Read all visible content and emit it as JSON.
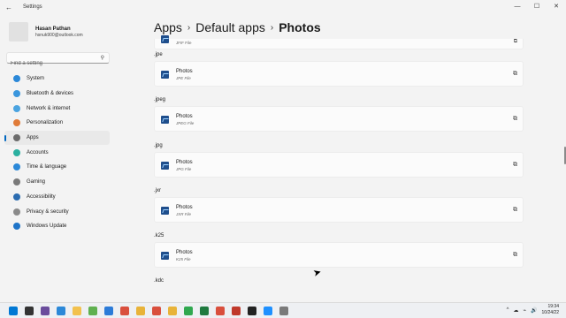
{
  "window": {
    "title": "Settings",
    "back_glyph": "←",
    "minimize_glyph": "—",
    "maximize_glyph": "☐",
    "close_glyph": "✕"
  },
  "profile": {
    "name": "Hasan Pathan",
    "email": "hsnuk900@outlook.com"
  },
  "search": {
    "placeholder": "Find a setting",
    "icon": "search-icon"
  },
  "nav": [
    {
      "label": "System",
      "color": "#2b88d8",
      "active": false
    },
    {
      "label": "Bluetooth & devices",
      "color": "#3a96dd",
      "active": false
    },
    {
      "label": "Network & internet",
      "color": "#4aa3e0",
      "active": false
    },
    {
      "label": "Personalization",
      "color": "#e07b39",
      "active": false
    },
    {
      "label": "Apps",
      "color": "#6b6b6b",
      "active": true
    },
    {
      "label": "Accounts",
      "color": "#2bb0a0",
      "active": false
    },
    {
      "label": "Time & language",
      "color": "#2b88d8",
      "active": false
    },
    {
      "label": "Gaming",
      "color": "#7a7a7a",
      "active": false
    },
    {
      "label": "Accessibility",
      "color": "#2b6cb0",
      "active": false
    },
    {
      "label": "Privacy & security",
      "color": "#8a8a8a",
      "active": false
    },
    {
      "label": "Windows Update",
      "color": "#1e74c8",
      "active": false
    }
  ],
  "breadcrumb": {
    "item1": "Apps",
    "item2": "Default apps",
    "current": "Photos",
    "sep": "›"
  },
  "top_card": {
    "file_type": "JFIF File",
    "open_glyph": "⧉"
  },
  "associations": [
    {
      "ext": ".jpe",
      "app": "Photos",
      "file_type": "JPE File"
    },
    {
      "ext": ".jpeg",
      "app": "Photos",
      "file_type": "JPEG File"
    },
    {
      "ext": ".jpg",
      "app": "Photos",
      "file_type": "JPG File"
    },
    {
      "ext": ".jxr",
      "app": "Photos",
      "file_type": "JXR File"
    },
    {
      "ext": ".k25",
      "app": "Photos",
      "file_type": "K25 File"
    },
    {
      "ext": ".kdc",
      "app": "",
      "file_type": ""
    }
  ],
  "open_glyph": "⧉",
  "taskbar": {
    "icons": [
      "#0078d4",
      "#333333",
      "#6a4c9c",
      "#2b88d8",
      "#f2c14e",
      "#5fb04f",
      "#2b7bd8",
      "#d94f3d",
      "#e8b339",
      "#d94f3d",
      "#e8b339",
      "#2fa84f",
      "#1f7a3f",
      "#d94f3d",
      "#c0392b",
      "#222222",
      "#1e90ff",
      "#7a7a7a"
    ],
    "tray": [
      "^",
      "☁",
      "⌁",
      "🔊"
    ],
    "time": "19:34",
    "date": "10/24/22"
  }
}
